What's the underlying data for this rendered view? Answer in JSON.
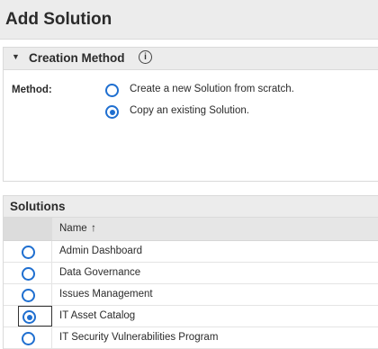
{
  "dialog": {
    "title": "Add Solution"
  },
  "creation_method": {
    "section_label": "Creation Method",
    "method_label": "Method:",
    "options": [
      {
        "label": "Create a new Solution from scratch.",
        "selected": false
      },
      {
        "label": "Copy an existing Solution.",
        "selected": true
      }
    ]
  },
  "solutions": {
    "section_label": "Solutions",
    "column_name": "Name",
    "sort_glyph": "↑",
    "rows": [
      {
        "name": "Admin Dashboard",
        "selected": false
      },
      {
        "name": "Data Governance",
        "selected": false
      },
      {
        "name": "Issues Management",
        "selected": false
      },
      {
        "name": "IT Asset Catalog",
        "selected": true
      },
      {
        "name": "IT Security Vulnerabilities Program",
        "selected": false
      }
    ]
  },
  "colors": {
    "accent": "#1f6fd0",
    "header_bg": "#ececec"
  }
}
